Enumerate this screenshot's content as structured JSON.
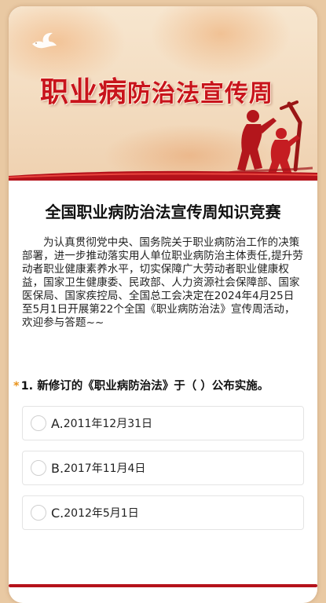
{
  "banner": {
    "title_part1": "职业病",
    "title_part2": "防治法宣传周",
    "accent_color": "#c8141c"
  },
  "quiz": {
    "title": "全国职业病防治法宣传周知识竞赛",
    "intro": "为认真贯彻党中央、国务院关于职业病防治工作的决策部署，进一步推动落实用人单位职业病防治主体责任,提升劳动者职业健康素养水平，切实保障广大劳动者职业健康权益，国家卫生健康委、民政部、人力资源社会保障部、国家医保局、国家疾控局、全国总工会决定在2024年4月25日至5月1日开展第22个全国《职业病防治法》宣传周活动，欢迎参与答题~~"
  },
  "question1": {
    "required_mark": "*",
    "label": "1. 新修订的《职业病防治法》于（ ）公布实施。",
    "options": [
      {
        "letter": "A.",
        "text": "2011年12月31日"
      },
      {
        "letter": "B.",
        "text": "2017年11月4日"
      },
      {
        "letter": "C.",
        "text": "2012年5月1日"
      }
    ]
  },
  "icons": {
    "dove": "dove-icon",
    "workers": "workers-silhouette-icon",
    "radio": "radio-unchecked-icon"
  }
}
